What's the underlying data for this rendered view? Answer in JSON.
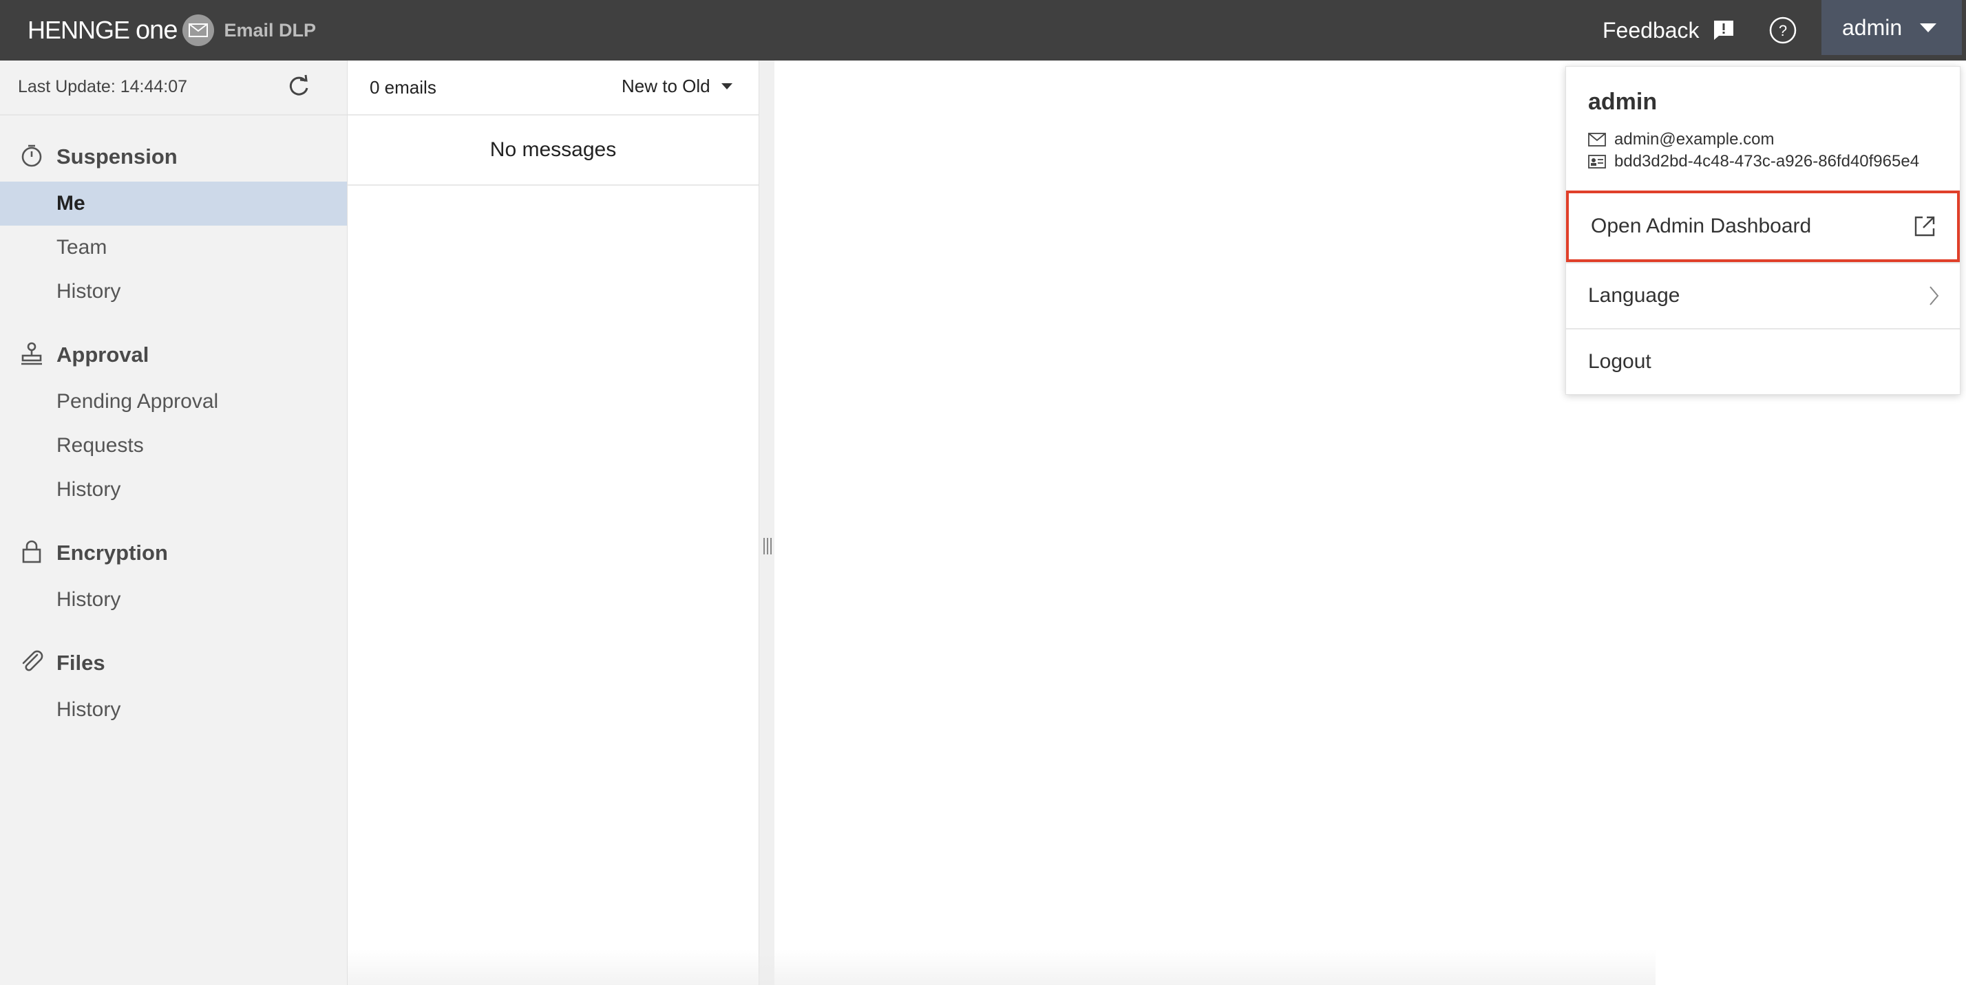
{
  "topbar": {
    "brand": "HENNGE",
    "brand_suffix": "one",
    "product": "Email DLP",
    "feedback_label": "Feedback",
    "user_label": "admin"
  },
  "sidebar": {
    "last_update": "Last Update: 14:44:07",
    "sections": [
      {
        "title": "Suspension",
        "icon": "stopwatch-icon",
        "items": [
          "Me",
          "Team",
          "History"
        ],
        "active": "Me"
      },
      {
        "title": "Approval",
        "icon": "stamp-icon",
        "items": [
          "Pending Approval",
          "Requests",
          "History"
        ]
      },
      {
        "title": "Encryption",
        "icon": "lock-icon",
        "items": [
          "History"
        ]
      },
      {
        "title": "Files",
        "icon": "paperclip-icon",
        "items": [
          "History"
        ]
      }
    ]
  },
  "list": {
    "count": "0 emails",
    "sort": "New to Old",
    "empty": "No messages"
  },
  "menu": {
    "name": "admin",
    "email": "admin@example.com",
    "id": "bdd3d2bd-4c48-473c-a926-86fd40f965e4",
    "items": [
      "Open Admin Dashboard",
      "Language",
      "Logout"
    ],
    "highlight_color": "#e0402a"
  },
  "colors": {
    "topbar": "#404040",
    "active_nav": "#cdd9e9",
    "user_button": "#4d5564"
  }
}
